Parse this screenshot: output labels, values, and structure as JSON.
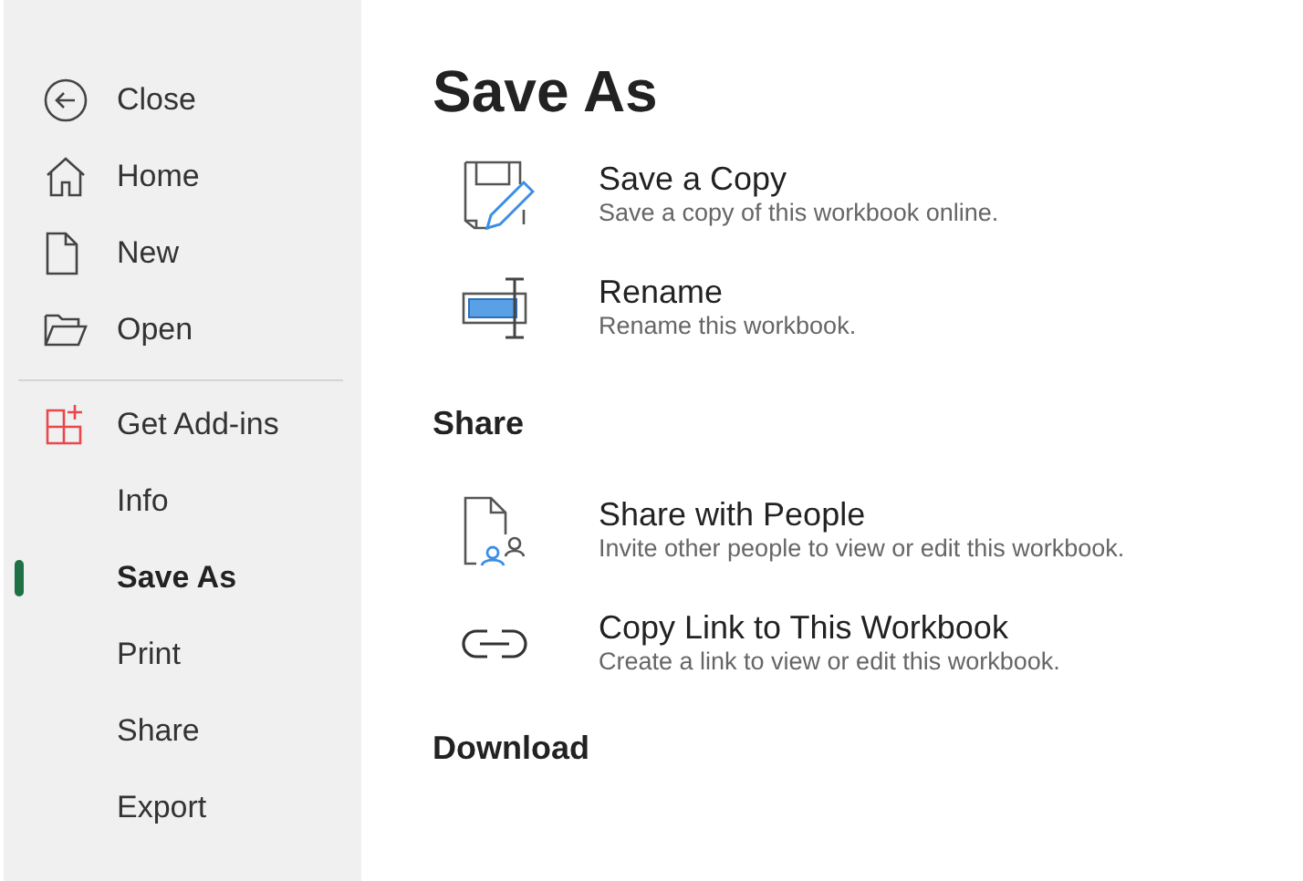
{
  "sidebar": {
    "items": [
      {
        "label": "Close",
        "selected": false
      },
      {
        "label": "Home",
        "selected": false
      },
      {
        "label": "New",
        "selected": false
      },
      {
        "label": "Open",
        "selected": false
      },
      {
        "label": "Get Add-ins",
        "selected": false
      },
      {
        "label": "Info",
        "selected": false
      },
      {
        "label": "Save As",
        "selected": true
      },
      {
        "label": "Print",
        "selected": false
      },
      {
        "label": "Share",
        "selected": false
      },
      {
        "label": "Export",
        "selected": false
      }
    ]
  },
  "main": {
    "title": "Save As",
    "sections": [
      {
        "options": [
          {
            "title": "Save a Copy",
            "description": "Save a copy of this workbook online."
          },
          {
            "title": "Rename",
            "description": "Rename this workbook."
          }
        ]
      },
      {
        "heading": "Share",
        "options": [
          {
            "title": "Share with People",
            "description": "Invite other people to view or edit this workbook."
          },
          {
            "title": "Copy Link to This Workbook",
            "description": "Create a link to view or edit this workbook."
          }
        ]
      },
      {
        "heading": "Download"
      }
    ]
  }
}
